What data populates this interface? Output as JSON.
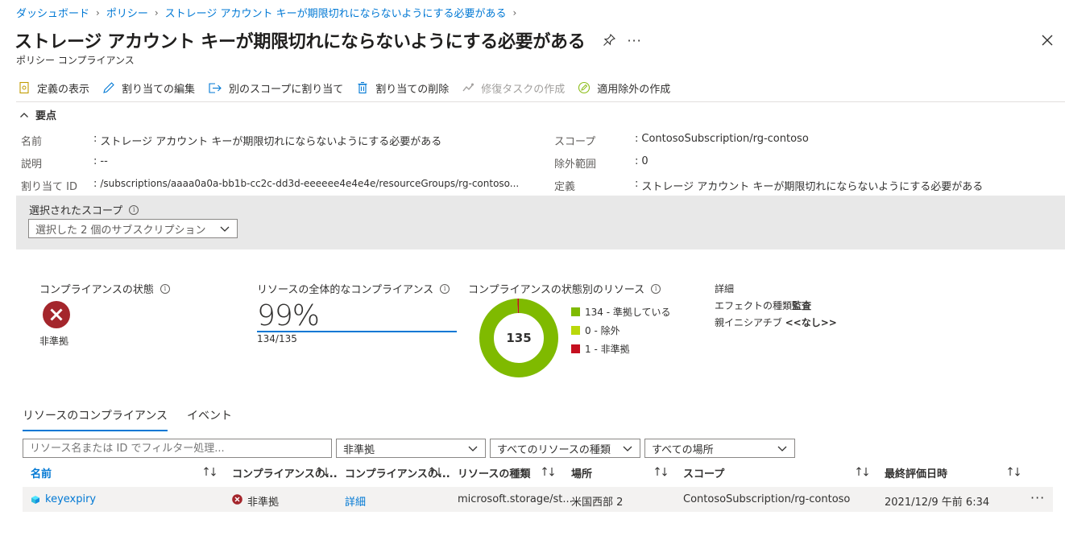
{
  "breadcrumb": [
    "ダッシュボード",
    "ポリシー",
    "ストレージ アカウント キーが期限切れにならないようにする必要がある"
  ],
  "header": {
    "title": "ストレージ アカウント キーが期限切れにならないようにする必要がある",
    "subtitle": "ポリシー コンプライアンス",
    "more": "···"
  },
  "toolbar": {
    "view_definition": "定義の表示",
    "edit_assignment": "割り当ての編集",
    "assign_other_scope": "別のスコープに割り当て",
    "delete_assignment": "割り当ての削除",
    "create_remediation": "修復タスクの作成",
    "create_exemption": "適用除外の作成"
  },
  "essentials": {
    "toggle_label": "要点",
    "name_label": "名前",
    "name_value": "ストレージ アカウント キーが期限切れにならないようにする必要がある",
    "desc_label": "説明",
    "desc_value": "--",
    "assignment_id_label": "割り当て ID",
    "assignment_id_value": "/subscriptions/aaaa0a0a-bb1b-cc2c-dd3d-eeeeee4e4e4e/resourceGroups/rg-contoso...",
    "scope_label": "スコープ",
    "scope_value": "ContosoSubscription/rg-contoso",
    "excluded_label": "除外範囲",
    "excluded_value": "0",
    "definition_label": "定義",
    "definition_value": "ストレージ アカウント キーが期限切れにならないようにする必要がある",
    "colon": ":"
  },
  "scope_filter": {
    "label": "選択されたスコープ",
    "value": "選択した 2 個のサブスクリプション"
  },
  "kpi": {
    "compliance_state_label": "コンプライアンスの状態",
    "compliance_state_value": "非準拠",
    "overall_label": "リソースの全体的なコンプライアンス",
    "overall_pct": "99%",
    "overall_ratio": "134/135",
    "by_state_label": "コンプライアンスの状態別のリソース",
    "donut_total": "135",
    "legend": [
      {
        "label": "134 - 準拠している",
        "value": 134,
        "color": "#7fba00"
      },
      {
        "label": "0 - 除外",
        "value": 0,
        "color": "#bad80a"
      },
      {
        "label": "1 - 非準拠",
        "value": 1,
        "color": "#c50f1f"
      }
    ],
    "details_label": "詳細",
    "effect_label": "エフェクトの種類",
    "effect_value": "監査",
    "parent_label": "親イニシアチブ",
    "parent_value": "<<なし>>"
  },
  "tabs": {
    "resource_compliance": "リソースのコンプライアンス",
    "events": "イベント"
  },
  "filters": {
    "search_placeholder": "リソース名または ID でフィルター処理...",
    "state": "非準拠",
    "resource_type": "すべてのリソースの種類",
    "location": "すべての場所"
  },
  "table": {
    "headers": [
      "名前",
      "コンプライアンスの...",
      "コンプライアンスの...",
      "リソースの種類",
      "場所",
      "スコープ",
      "最終評価日時"
    ],
    "rows": [
      {
        "name": "keyexpiry",
        "state": "非準拠",
        "detail": "詳細",
        "type": "microsoft.storage/st...",
        "location": "米国西部 2",
        "scope": "ContosoSubscription/rg-contoso",
        "last_eval": "2021/12/9 午前 6:34",
        "more": "···"
      }
    ]
  }
}
